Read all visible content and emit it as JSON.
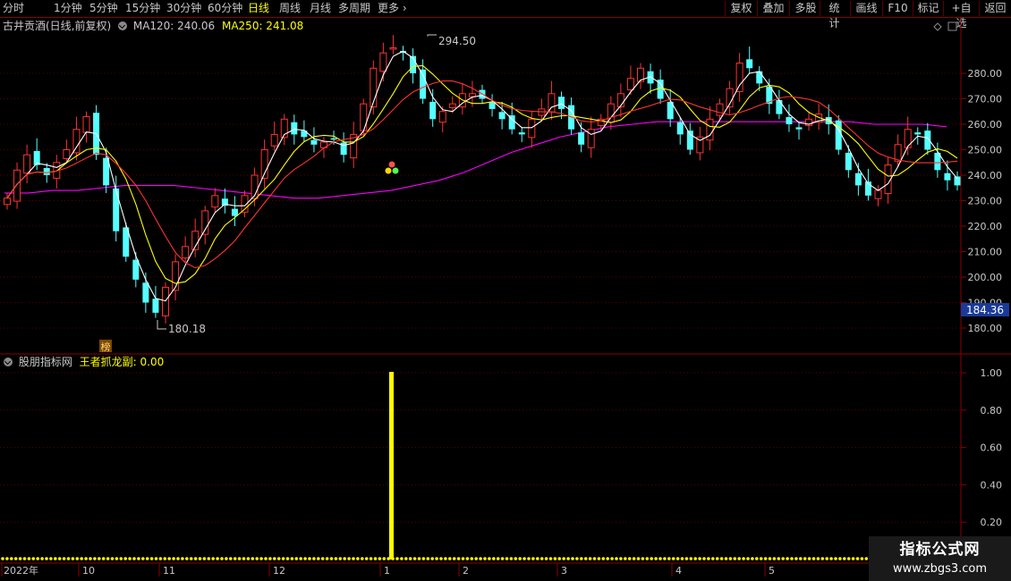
{
  "toolbar": {
    "periods": [
      "分时",
      "1分钟",
      "5分钟",
      "15分钟",
      "30分钟",
      "60分钟",
      "日线",
      "周线",
      "月线",
      "多周期",
      "更多"
    ],
    "active_period": "日线",
    "right_buttons": [
      "复权",
      "叠加",
      "多股",
      "统计",
      "画线",
      "F10",
      "标记",
      "+自选",
      "返回"
    ]
  },
  "main_chart": {
    "stock_title": "古井贡酒(日线,前复权)",
    "ma120_label": "MA120: 240.06",
    "ma250_label": "MA250: 241.08",
    "high_label": "294.50",
    "low_label": "180.18",
    "bang_tag": "榜",
    "price_tag": "184.36",
    "y_ticks": [
      "280.00",
      "270.00",
      "260.00",
      "250.00",
      "240.00",
      "230.00",
      "220.00",
      "210.00",
      "200.00",
      "190.00",
      "180.00"
    ]
  },
  "sub_chart": {
    "title": "股朋指标网",
    "indicator_label": "王者抓龙副: 0.00",
    "y_ticks": [
      "1.00",
      "0.80",
      "0.60",
      "0.40",
      "0.20"
    ]
  },
  "x_axis": {
    "labels": [
      "2022年",
      "10",
      "11",
      "12",
      "1",
      "2",
      "3",
      "4",
      "5"
    ]
  },
  "watermark": {
    "title": "指标公式网",
    "url": "www.zbgs3.com"
  },
  "colors": {
    "up": "#ff3232",
    "down": "#54ffff",
    "ma5": "#ffffff",
    "ma10": "#ffff00",
    "ma20": "#ff3232",
    "ma60": "#ff00ff",
    "signal": "#ffff00",
    "axis": "#8b0000",
    "active_tab": "#ffff00"
  },
  "chart_data": {
    "type": "candlestick",
    "ylim": [
      175,
      298
    ],
    "series": [
      {
        "name": "MA120",
        "values": [
          233,
          233,
          234,
          234,
          235,
          236,
          236,
          236,
          235,
          234,
          233,
          232,
          231,
          231,
          232,
          233,
          234,
          236,
          238,
          241,
          245,
          249,
          252,
          255,
          257,
          259,
          260,
          261,
          261,
          261,
          261,
          261,
          261,
          261,
          261,
          261,
          260,
          260,
          260,
          259
        ]
      },
      {
        "name": "MA250",
        "values": [
          236,
          238,
          239,
          239,
          238,
          236,
          234,
          232,
          231,
          230,
          229,
          228,
          228,
          228,
          230,
          234,
          240,
          246,
          251,
          254,
          257,
          259,
          260,
          262,
          263,
          264,
          264,
          265,
          265,
          265,
          265,
          265,
          265,
          265,
          265,
          265,
          263,
          262,
          261,
          260
        ]
      }
    ],
    "closes": [
      231,
      242,
      248,
      244,
      240,
      245,
      250,
      258,
      263,
      248,
      236,
      218,
      208,
      199,
      190,
      186,
      196,
      206,
      212,
      218,
      226,
      232,
      228,
      224,
      232,
      240,
      250,
      256,
      262,
      256,
      255,
      252,
      253,
      254,
      248,
      256,
      268,
      282,
      288,
      290,
      288,
      280,
      270,
      262,
      265,
      268,
      272,
      272,
      270,
      266,
      262,
      258,
      256,
      262,
      266,
      272,
      266,
      258,
      252,
      258,
      262,
      268,
      272,
      278,
      282,
      276,
      270,
      262,
      256,
      250,
      255,
      262,
      268,
      274,
      284,
      282,
      276,
      268,
      264,
      260,
      258,
      262,
      264,
      260,
      250,
      242,
      236,
      232,
      234,
      244,
      252,
      258,
      256,
      250,
      242,
      238,
      236
    ]
  }
}
